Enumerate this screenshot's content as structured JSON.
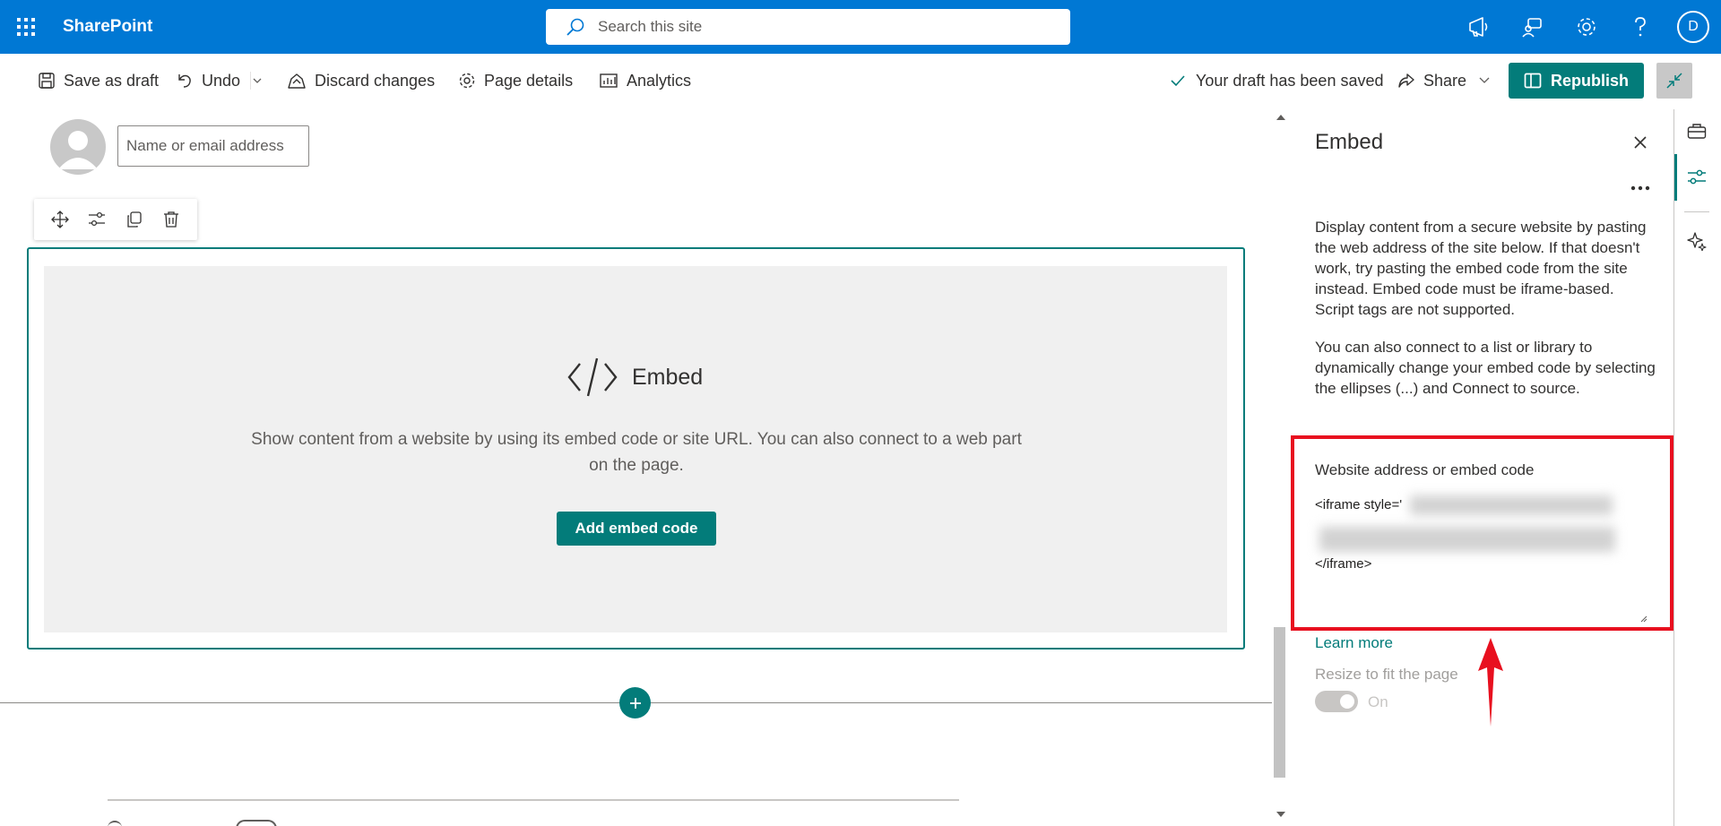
{
  "suite": {
    "app_name": "SharePoint",
    "search_placeholder": "Search this site",
    "avatar_initial": "D"
  },
  "commandbar": {
    "save_draft": "Save as draft",
    "undo": "Undo",
    "discard": "Discard changes",
    "page_details": "Page details",
    "analytics": "Analytics",
    "status": "Your draft has been saved",
    "share": "Share",
    "republish": "Republish"
  },
  "canvas": {
    "name_placeholder": "Name or email address",
    "webpart_title": "Embed",
    "webpart_description": "Show content from a website by using its embed code or site URL. You can also connect to a web part on the page.",
    "add_embed_button": "Add embed code"
  },
  "pane": {
    "title": "Embed",
    "description_1": "Display content from a secure website by pasting the web address of the site below. If that doesn't work, try pasting the embed code from the site instead. Embed code must be iframe-based. Script tags are not supported.",
    "description_2": "You can also connect to a list or library to dynamically change your embed code by selecting the ellipses (...) and Connect to source.",
    "field_label": "Website address or embed code",
    "code_start": "<iframe style='",
    "code_end": "</iframe>",
    "learn_more": "Learn more",
    "resize_label": "Resize to fit the page",
    "toggle_state": "On"
  },
  "colors": {
    "suite_blue": "#0078d4",
    "teal_accent": "#037c7a",
    "highlight_red": "#e8101f"
  },
  "icons": [
    "waffle-icon",
    "search-icon",
    "megaphone-icon",
    "feedback-icon",
    "gear-icon",
    "help-icon",
    "save-icon",
    "undo-icon",
    "discard-icon",
    "gear-icon",
    "analytics-icon",
    "checkmark-icon",
    "share-icon",
    "book-icon",
    "collapse-icon",
    "move-icon",
    "settings-sliders-icon",
    "duplicate-icon",
    "delete-icon",
    "code-icon",
    "plus-icon",
    "close-icon",
    "more-icon",
    "toolbox-icon",
    "sparkle-icon",
    "arrow-up-icon"
  ]
}
